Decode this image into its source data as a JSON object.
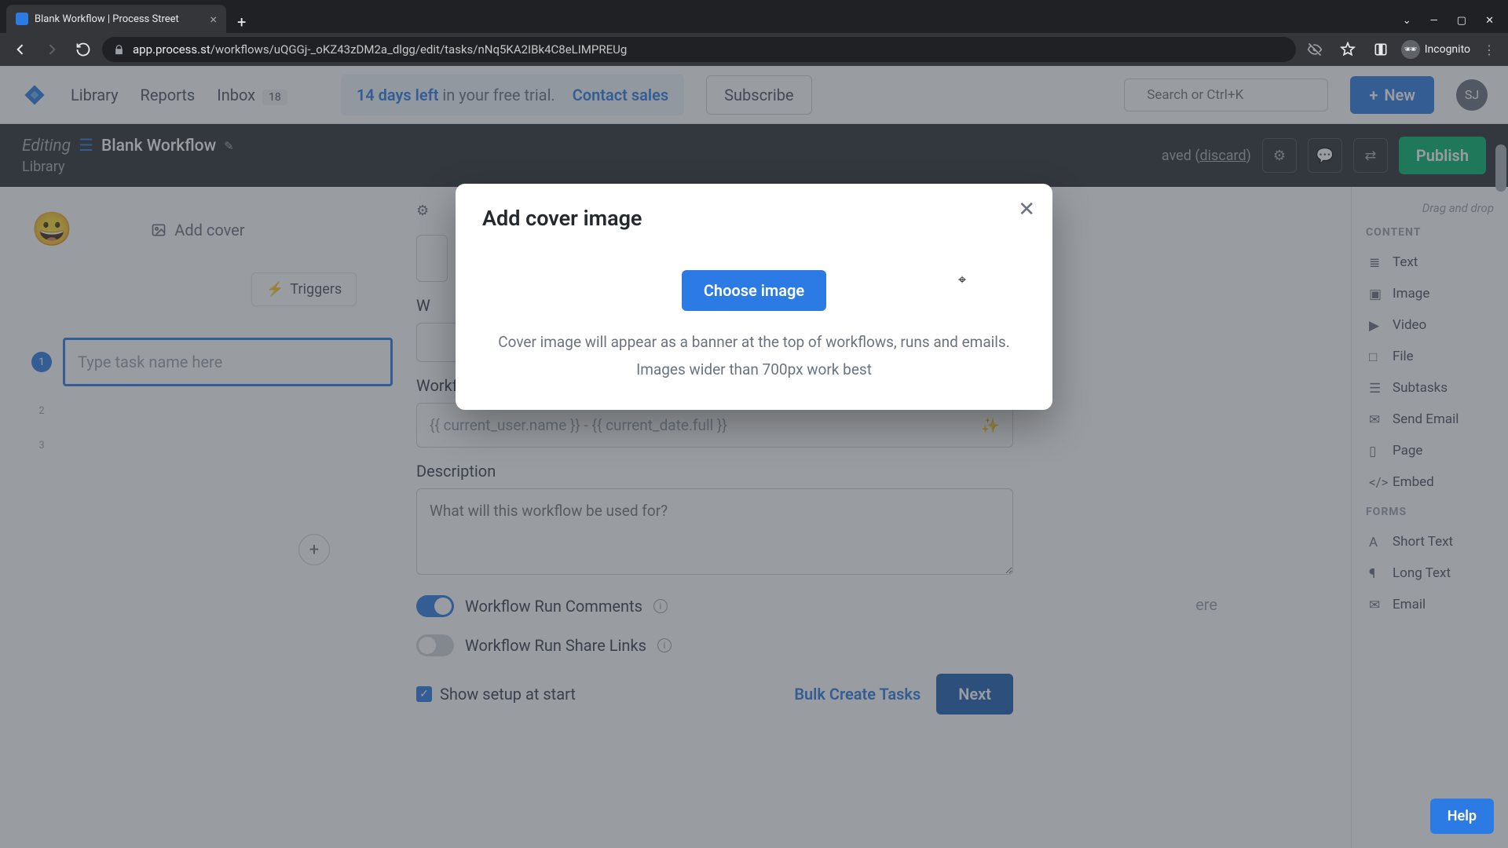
{
  "browser": {
    "tab_title": "Blank Workflow | Process Street",
    "url_prefix": "app.process.st",
    "url_path": "/workflows/uQGGj-_oKZ43zDM2a_dlgg/edit/tasks/nNq5KA2IBk4C8eLIMPREUg",
    "incognito_label": "Incognito"
  },
  "nav": {
    "library": "Library",
    "reports": "Reports",
    "inbox": "Inbox",
    "inbox_count": "18",
    "trial_days": "14 days left",
    "trial_rest": " in your free trial.",
    "contact_sales": "Contact sales",
    "subscribe": "Subscribe",
    "search_placeholder": "Search or Ctrl+K",
    "new": "New",
    "avatar": "SJ"
  },
  "editbar": {
    "editing": "Editing",
    "workflow_name": "Blank Workflow",
    "breadcrumb": "Library",
    "saved_prefix": "aved (",
    "discard": "discard",
    "saved_suffix": ")",
    "publish": "Publish"
  },
  "left": {
    "emoji": "😀",
    "add_cover": "Add cover",
    "triggers": "Triggers",
    "task_placeholder": "Type task name here",
    "row2": "2",
    "row3": "3"
  },
  "form": {
    "run_name_label": "Workflow Run Name",
    "run_name_placeholder": "{{ current_user.name }} - {{ current_date.full }}",
    "description_label": "Description",
    "description_placeholder": "What will this workflow be used for?",
    "comments_label": "Workflow Run Comments",
    "sharelinks_label": "Workflow Run Share Links",
    "show_setup": "Show setup at start",
    "bulk_create": "Bulk Create Tasks",
    "next": "Next",
    "drag_here": "ere",
    "w_label": "W"
  },
  "sidebar": {
    "hint": "Drag and drop",
    "content_heading": "CONTENT",
    "items_content": [
      "Text",
      "Image",
      "Video",
      "File",
      "Subtasks",
      "Send Email",
      "Page",
      "Embed"
    ],
    "forms_heading": "FORMS",
    "items_forms": [
      "Short Text",
      "Long Text",
      "Email"
    ]
  },
  "modal": {
    "title": "Add cover image",
    "choose": "Choose image",
    "help1": "Cover image will appear as a banner at the top of workflows, runs and emails.",
    "help2": "Images wider than 700px work best"
  },
  "help": "Help"
}
